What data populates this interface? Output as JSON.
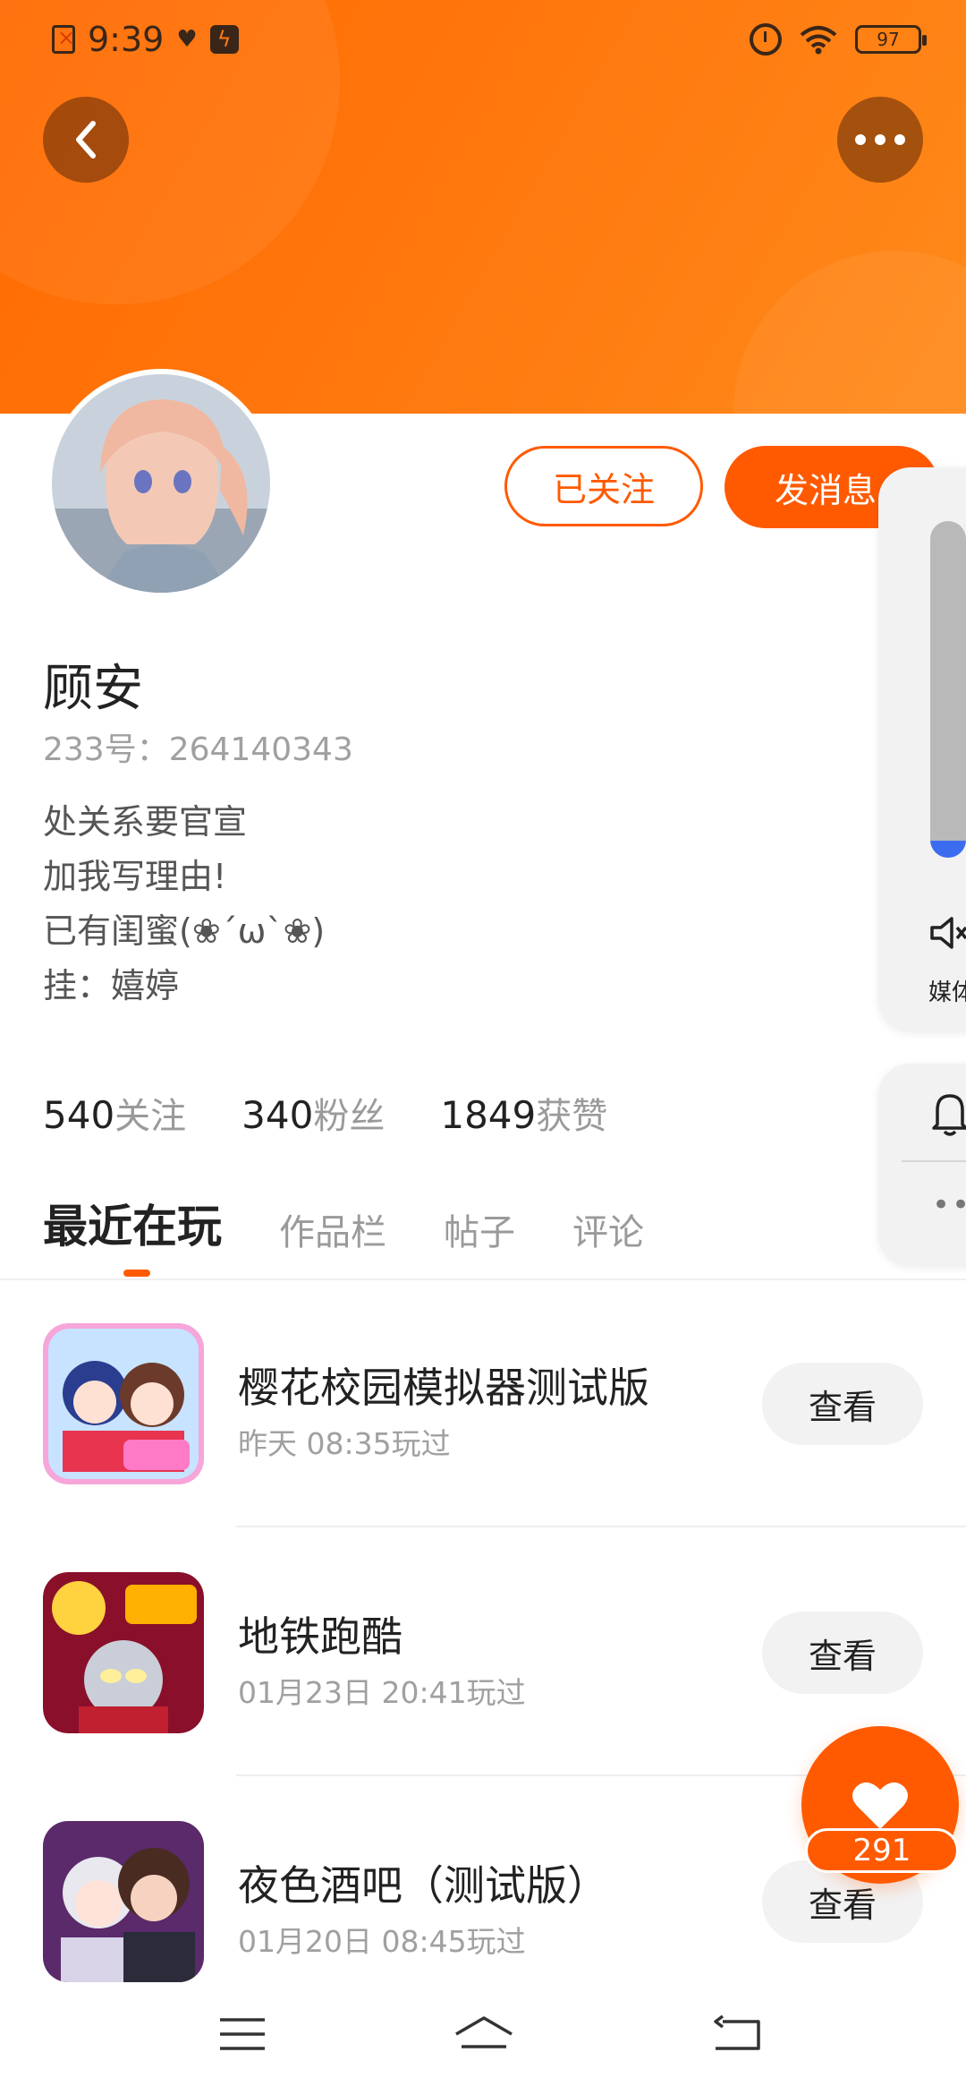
{
  "status_bar": {
    "time": "9:39",
    "battery": "97",
    "icons": [
      "sim-error-icon",
      "heart-icon",
      "bolt-icon",
      "alarm-icon",
      "wifi-icon",
      "battery-icon"
    ]
  },
  "header": {
    "back_icon": "chevron-left-icon",
    "more_icon": "more-dots-icon"
  },
  "profile": {
    "name": "顾安",
    "uid_label": "233号：",
    "uid_value": "264140343",
    "bio": [
      "处关系要官宣",
      "加我写理由!",
      "已有闺蜜(❀´ω`❀)",
      "挂：嬉婷"
    ],
    "follow_btn": "已关注",
    "message_btn": "发消息"
  },
  "stats": [
    {
      "value": "540",
      "label": "关注"
    },
    {
      "value": "340",
      "label": "粉丝"
    },
    {
      "value": "1849",
      "label": "获赞"
    }
  ],
  "tabs": [
    "最近在玩",
    "作品栏",
    "帖子",
    "评论"
  ],
  "games": [
    {
      "title": "樱花校园模拟器测试版",
      "time": "昨天 08:35玩过",
      "button": "查看"
    },
    {
      "title": "地铁跑酷",
      "time": "01月23日 20:41玩过",
      "button": "查看"
    },
    {
      "title": "夜色酒吧（测试版）",
      "time": "01月20日 08:45玩过",
      "button": "查看"
    }
  ],
  "like": {
    "count": "291"
  },
  "volume_overlay": {
    "level": 0.05,
    "label": "媒体",
    "accent": "#3b6cf0"
  },
  "colors": {
    "brand": "#ff5a00",
    "banner": "#ff7a10"
  }
}
